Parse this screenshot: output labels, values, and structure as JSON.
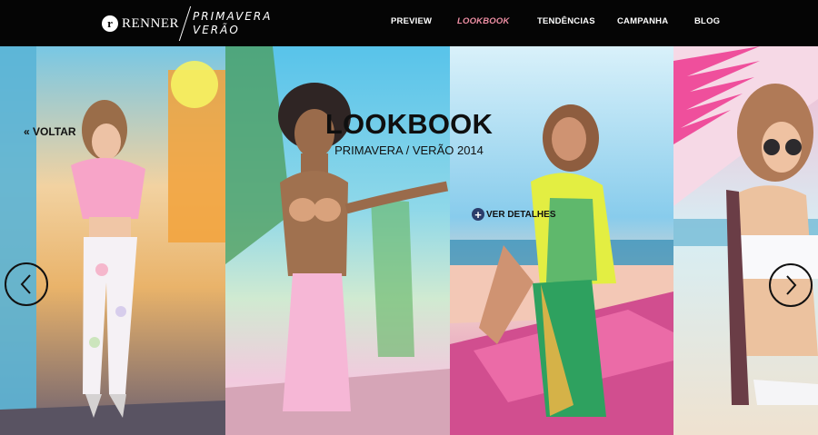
{
  "header": {
    "brand_mark": "r",
    "brand_name": "RENNER",
    "season_line_1": "PRIMAVERA",
    "season_line_2": "VERÃO"
  },
  "nav": {
    "items": [
      {
        "label": "PREVIEW",
        "active": false
      },
      {
        "label": "LOOKBOOK",
        "active": true
      },
      {
        "label": "TENDÊNCIAS",
        "active": false
      },
      {
        "label": "CAMPANHA",
        "active": false
      },
      {
        "label": "BLOG",
        "active": false
      }
    ]
  },
  "lookbook": {
    "title": "LOOKBOOK",
    "subtitle": "PRIMAVERA / VERÃO 2014"
  },
  "controls": {
    "back_label": "« VOLTAR",
    "details_label": "VER DETALHES",
    "details_icon": "plus-icon",
    "prev_icon": "chevron-left-icon",
    "next_icon": "chevron-right-icon"
  },
  "colors": {
    "header_bg": "#050505",
    "nav_active": "#ef8fa4",
    "text_dark": "#111111"
  }
}
